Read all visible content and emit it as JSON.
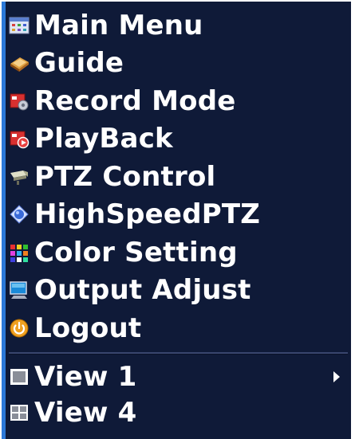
{
  "menu": {
    "items": [
      {
        "label": "Main Menu",
        "icon": "main-menu-icon"
      },
      {
        "label": "Guide",
        "icon": "guide-book-icon"
      },
      {
        "label": "Record Mode",
        "icon": "record-mode-icon"
      },
      {
        "label": "PlayBack",
        "icon": "playback-icon"
      },
      {
        "label": "PTZ Control",
        "icon": "ptz-camera-icon"
      },
      {
        "label": "HighSpeedPTZ",
        "icon": "high-speed-ptz-icon"
      },
      {
        "label": "Color Setting",
        "icon": "color-palette-icon"
      },
      {
        "label": "Output Adjust",
        "icon": "monitor-icon"
      },
      {
        "label": "Logout",
        "icon": "power-icon"
      }
    ],
    "views": [
      {
        "label": "View 1",
        "icon": "single-view-icon",
        "has_submenu": true
      },
      {
        "label": "View 4",
        "icon": "quad-view-icon",
        "has_submenu": false
      }
    ]
  },
  "colors": {
    "background": "#0f1a38",
    "accent_border": "#2b78d8",
    "text": "#ffffff"
  }
}
